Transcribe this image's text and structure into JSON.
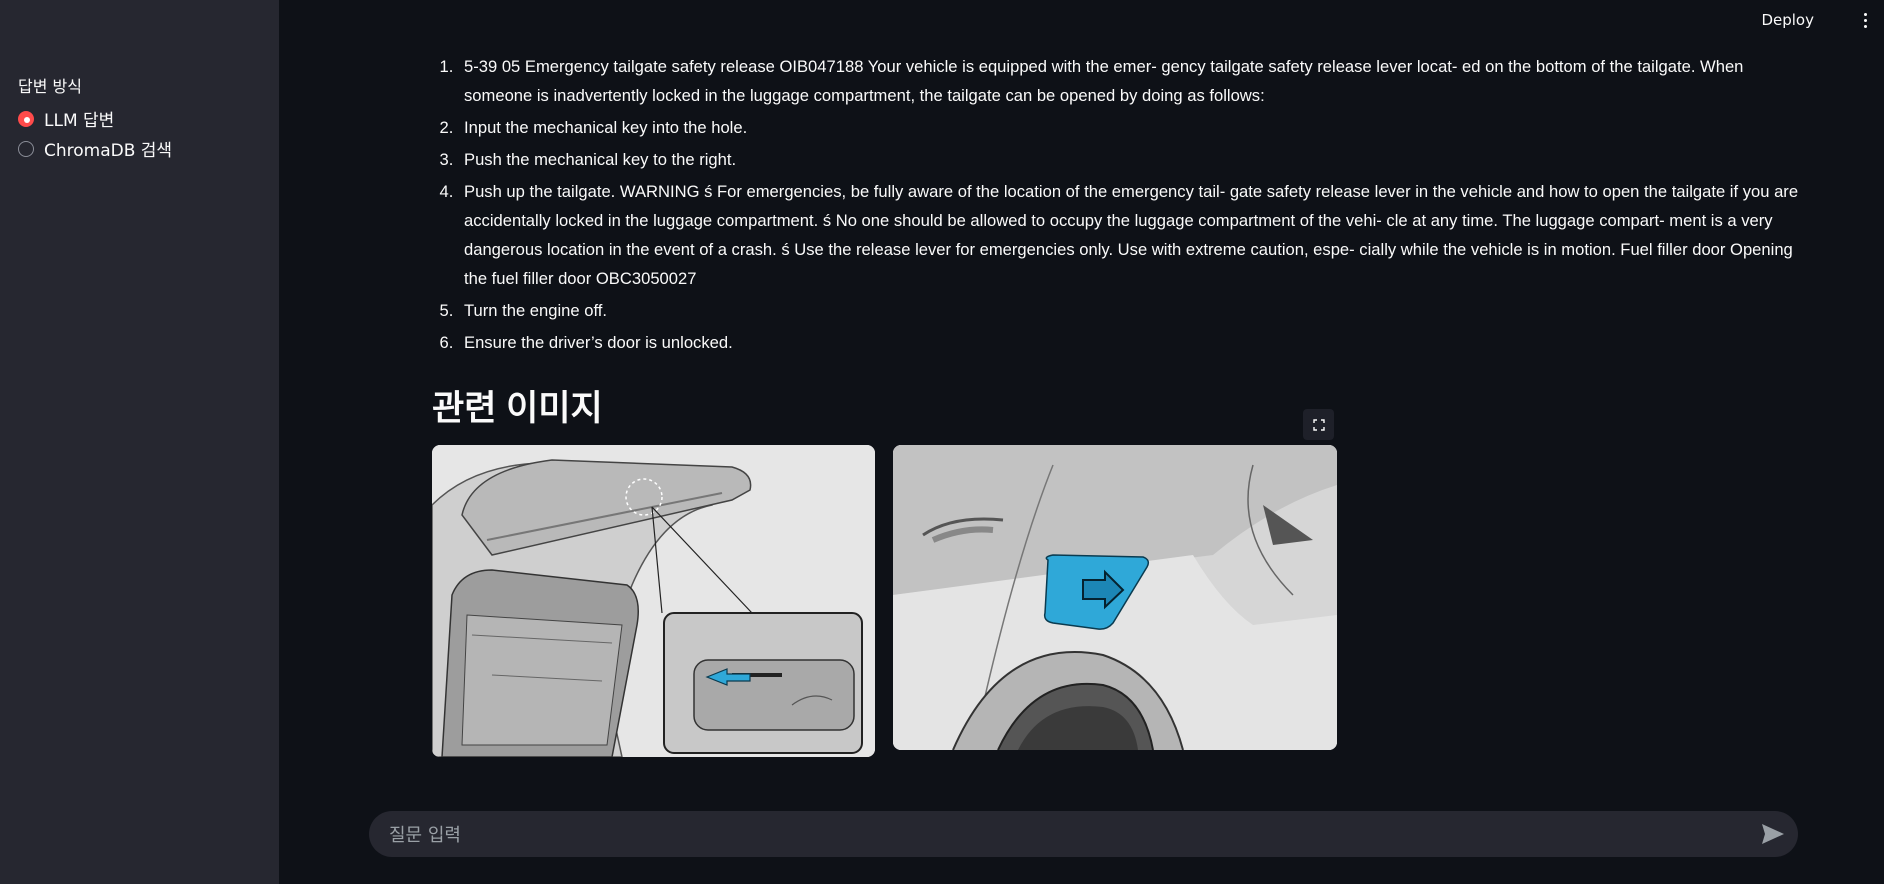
{
  "sidebar": {
    "label": "답변 방식",
    "options": [
      {
        "label": "LLM 답변",
        "selected": true
      },
      {
        "label": "ChromaDB 검색",
        "selected": false
      }
    ]
  },
  "topbar": {
    "deploy_label": "Deploy",
    "menu_icon": "kebab-menu-icon"
  },
  "answer": {
    "items": [
      "5-39 05 Emergency tailgate safety release OIB047188 Your vehicle is equipped with the emer- gency tailgate safety release lever locat- ed on the bottom of the tailgate. When someone is inadvertently locked in the luggage compartment, the tailgate can be opened by doing as follows:",
      "Input the mechanical key into the hole.",
      "Push the mechanical key to the right.",
      "Push up the tailgate. WARNING ś For emergencies, be fully aware of the location of the emergency tail- gate safety release lever in the vehicle and how to open the tailgate if you are accidentally locked in the luggage compartment. ś No one should be allowed to occupy the luggage compartment of the vehi- cle at any time. The luggage compart- ment is a very dangerous location in the event of a crash. ś Use the release lever for emergencies only. Use with extreme caution, espe- cially while the vehicle is in motion. Fuel filler door Opening the fuel filler door OBC3050027",
      "Turn the engine off.",
      "Ensure the driver’s door is unlocked."
    ]
  },
  "images_section": {
    "title": "관련 이미지",
    "fullscreen_icon": "fullscreen-icon",
    "images": [
      {
        "subject": "tailgate-safety-release-illustration"
      },
      {
        "subject": "fuel-filler-door-illustration"
      }
    ]
  },
  "chat": {
    "placeholder": "질문 입력",
    "send_icon": "send-icon"
  },
  "colors": {
    "accent": "#ff4b4b",
    "background": "#0e1117",
    "sidebar": "#262730",
    "highlight_blue": "#2fa8d8"
  }
}
